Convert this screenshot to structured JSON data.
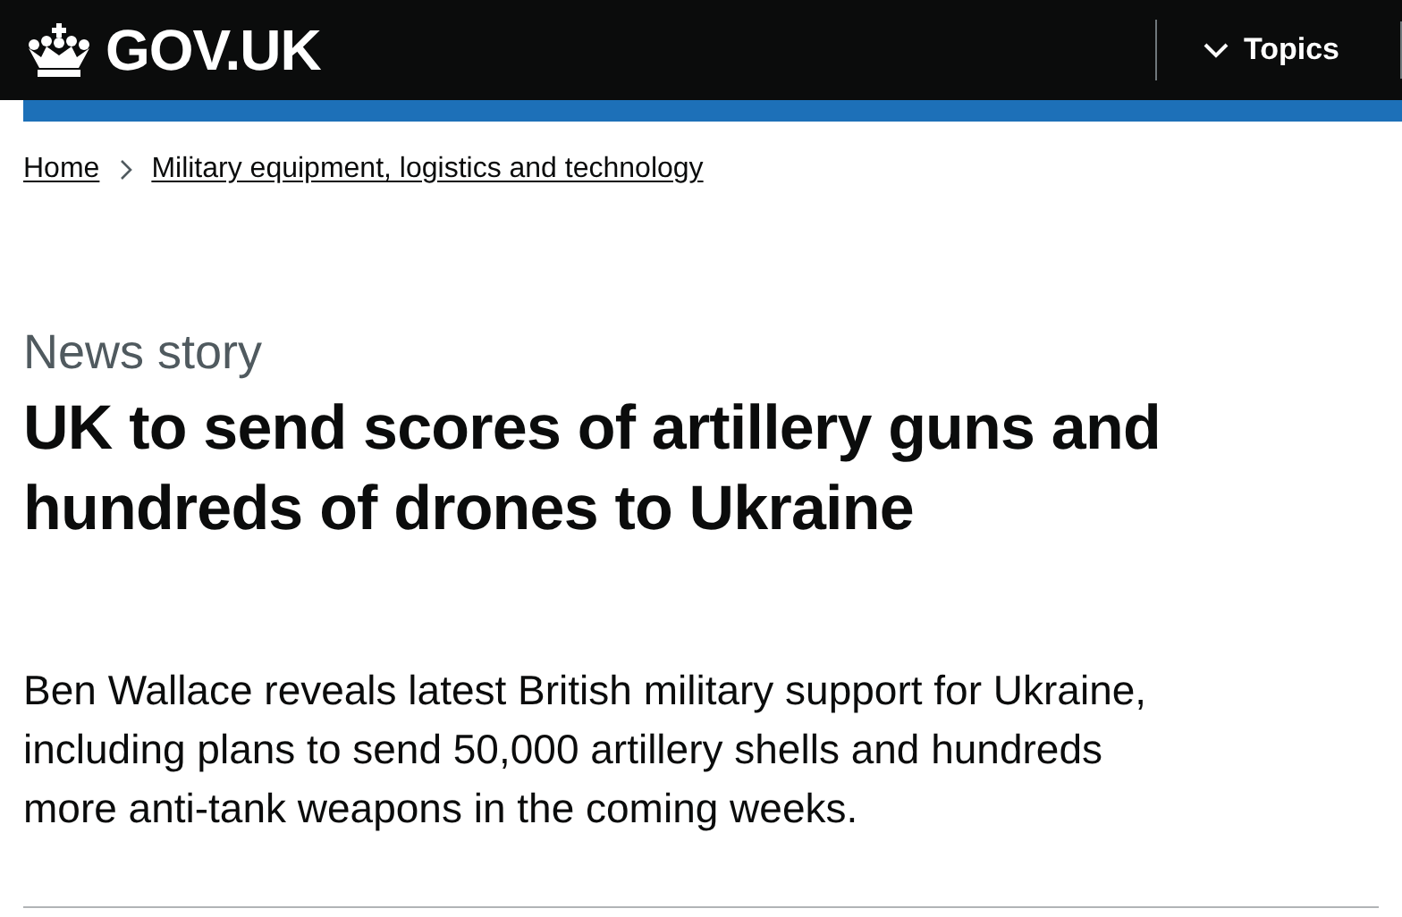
{
  "header": {
    "logo": "GOV.UK",
    "menu_button": "Topics"
  },
  "breadcrumbs": [
    {
      "label": "Home"
    },
    {
      "label": "Military equipment, logistics and technology"
    }
  ],
  "article": {
    "type": "News story",
    "title": "UK to send scores of artillery guns and hundreds of drones to Ukraine",
    "summary": "Ben Wallace reveals latest British military support for Ukraine, including plans to send 50,000 artillery shells and hundreds more anti-tank weapons in the coming weeks."
  }
}
